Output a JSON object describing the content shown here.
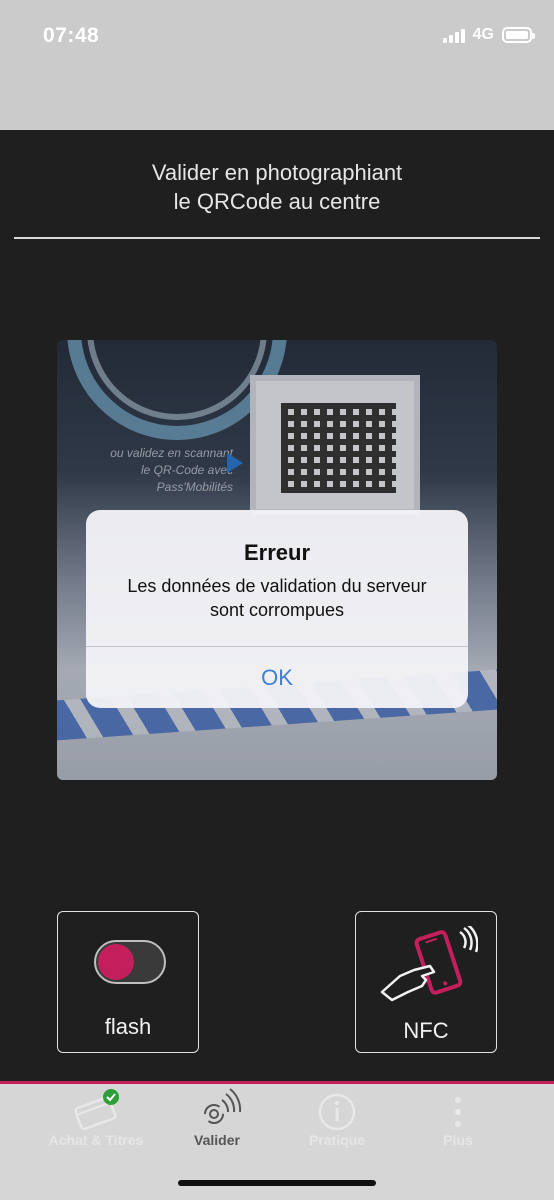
{
  "status_bar": {
    "time": "07:48",
    "network": "4G",
    "signal_bars": 4,
    "battery_level": 1.0
  },
  "instruction": {
    "line1": "Valider en photographiant",
    "line2": "le QRCode au centre"
  },
  "camera_preview": {
    "scene_text": [
      "ou validez en scannant",
      "le QR-Code avec",
      "Pass'Mobilités"
    ]
  },
  "alert": {
    "title": "Erreur",
    "message_line1": "Les données de validation du serveur",
    "message_line2": "sont corrompues",
    "ok_label": "OK"
  },
  "controls": {
    "flash_label": "flash",
    "flash_on": true,
    "nfc_label": "NFC"
  },
  "tabbar": {
    "tabs": [
      {
        "label": "Achat & Titres",
        "icon": "ticket-card-icon",
        "badge": "check-badge-icon"
      },
      {
        "label": "Valider",
        "icon": "contactless-validate-icon",
        "active": true
      },
      {
        "label": "Pratique",
        "icon": "info-circle-icon"
      },
      {
        "label": "Plus",
        "icon": "more-vertical-icon"
      }
    ]
  },
  "colors": {
    "accent": "#c21f5b",
    "link_blue": "#3f7dd8",
    "background": "#1f1f1f",
    "top_band": "#cbcbcb",
    "tabbar_bg": "#d6d6d6",
    "badge_green": "#2e9e3a"
  }
}
